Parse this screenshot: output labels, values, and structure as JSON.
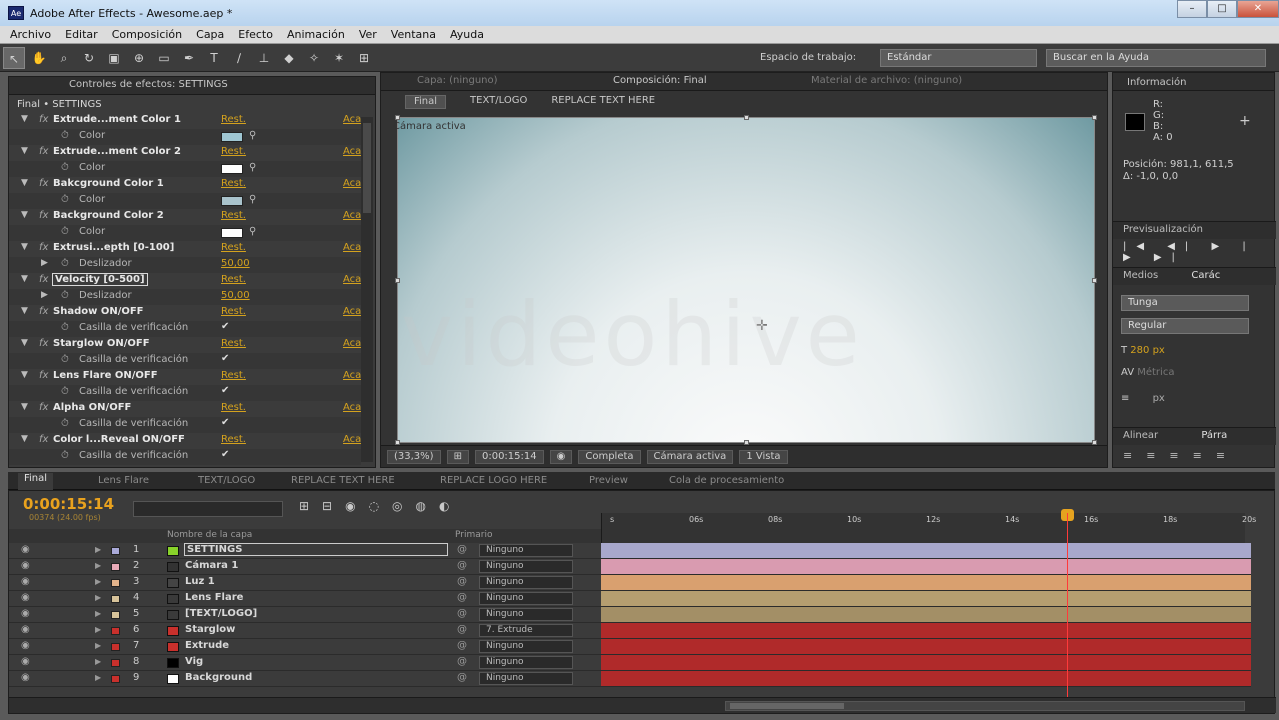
{
  "window": {
    "title": "Adobe After Effects - Awesome.aep *",
    "app_icon": "Ae"
  },
  "menu": [
    "Archivo",
    "Editar",
    "Composición",
    "Capa",
    "Efecto",
    "Animación",
    "Ver",
    "Ventana",
    "Ayuda"
  ],
  "toolbar": {
    "workspace_label": "Espacio de trabajo:",
    "workspace_value": "Estándar",
    "help_search": "Buscar en la Ayuda"
  },
  "effects": {
    "tab": "Controles de efectos: SETTINGS",
    "subtitle": "Final • SETTINGS",
    "reset_label": "Rest.",
    "about_label": "Aca",
    "rows": [
      {
        "kind": "eff",
        "name": "Extrude...ment Color 1"
      },
      {
        "kind": "prop",
        "name": "Color",
        "type": "color",
        "color": "#9fc6d2"
      },
      {
        "kind": "eff",
        "name": "Extrude...ment Color 2"
      },
      {
        "kind": "prop",
        "name": "Color",
        "type": "color",
        "color": "#ffffff"
      },
      {
        "kind": "eff",
        "name": "Bakcground Color 1"
      },
      {
        "kind": "prop",
        "name": "Color",
        "type": "color",
        "color": "#a9c3cc"
      },
      {
        "kind": "eff",
        "name": "Background Color 2"
      },
      {
        "kind": "prop",
        "name": "Color",
        "type": "color",
        "color": "#ffffff"
      },
      {
        "kind": "eff",
        "name": "Extrusi...epth [0-100]"
      },
      {
        "kind": "prop",
        "name": "Deslizador",
        "type": "value",
        "value": "50,00"
      },
      {
        "kind": "eff",
        "name": "Velocity [0-500]",
        "selected": true
      },
      {
        "kind": "prop",
        "name": "Deslizador",
        "type": "value",
        "value": "50,00"
      },
      {
        "kind": "eff",
        "name": "Shadow ON/OFF"
      },
      {
        "kind": "prop",
        "name": "Casilla de verificación",
        "type": "check"
      },
      {
        "kind": "eff",
        "name": "Starglow ON/OFF"
      },
      {
        "kind": "prop",
        "name": "Casilla de verificación",
        "type": "check"
      },
      {
        "kind": "eff",
        "name": "Lens Flare ON/OFF"
      },
      {
        "kind": "prop",
        "name": "Casilla de verificación",
        "type": "check"
      },
      {
        "kind": "eff",
        "name": "Alpha ON/OFF"
      },
      {
        "kind": "prop",
        "name": "Casilla de verificación",
        "type": "check"
      },
      {
        "kind": "eff",
        "name": "Color l...Reveal ON/OFF"
      },
      {
        "kind": "prop",
        "name": "Casilla de verificación",
        "type": "check"
      }
    ]
  },
  "composition": {
    "tabs": [
      "Capa: (ninguno)",
      "Composición: Final",
      "Material de archivo: (ninguno)"
    ],
    "flow": [
      "Final",
      "TEXT/LOGO",
      "REPLACE TEXT HERE"
    ],
    "camera_label": "Cámara activa",
    "zoom": "(33,3%)",
    "timecode": "0:00:15:14",
    "resolution": "Completa",
    "view_camera": "Cámara activa",
    "views": "1 Vista"
  },
  "info": {
    "tab": "Información",
    "rgb": [
      "R:",
      "G:",
      "B:",
      "A: 0"
    ],
    "position": "Posición: 981,1, 611,5",
    "delta": "Δ: -1,0, 0,0"
  },
  "preview": {
    "tab": "Previsualización",
    "controls": "|◀ ◀| ▶ |▶ ▶|"
  },
  "character": {
    "tabs": [
      "Medios",
      "Carác"
    ],
    "font": "Tunga",
    "style": "Regular",
    "size": "280 px",
    "kerning": "Métrica",
    "unit": "px"
  },
  "align": {
    "tabs": [
      "Alinear",
      "Párra"
    ]
  },
  "timeline": {
    "tabs": [
      "Final",
      "Lens Flare",
      "TEXT/LOGO",
      "REPLACE TEXT HERE",
      "REPLACE LOGO HERE",
      "Preview",
      "Cola de procesamiento"
    ],
    "timecode": "0:00:15:14",
    "timecode_small": "00374 (24.00 fps)",
    "col_name": "Nombre de la capa",
    "col_parent": "Primario",
    "ruler": [
      "s",
      "06s",
      "08s",
      "10s",
      "12s",
      "14s",
      "16s",
      "18s",
      "20s"
    ],
    "layers": [
      {
        "num": "1",
        "name": "SETTINGS",
        "label": "#a9a9d8",
        "src": "#88d22a",
        "parent": "Ninguno",
        "bar": "#a8a8cc",
        "selected": true
      },
      {
        "num": "2",
        "name": "Cámara 1",
        "label": "#e8aab8",
        "src": "#333333",
        "parent": "Ninguno",
        "bar": "#d99bb0"
      },
      {
        "num": "3",
        "name": "Luz 1",
        "label": "#e4b48c",
        "src": "#444444",
        "parent": "Ninguno",
        "bar": "#d9a06f"
      },
      {
        "num": "4",
        "name": "Lens Flare",
        "label": "#d7c39a",
        "src": "#3a3a3a",
        "parent": "Ninguno",
        "bar": "#b59e70"
      },
      {
        "num": "5",
        "name": "[TEXT/LOGO]",
        "label": "#d7c39a",
        "src": "#3a3a3a",
        "parent": "Ninguno",
        "bar": "#a38f66"
      },
      {
        "num": "6",
        "name": "Starglow",
        "label": "#c8302c",
        "src": "#c8302c",
        "parent": "7. Extrude",
        "bar": "#b02a2a"
      },
      {
        "num": "7",
        "name": "Extrude",
        "label": "#c8302c",
        "src": "#c8302c",
        "parent": "Ninguno",
        "bar": "#b02a2a"
      },
      {
        "num": "8",
        "name": "Vig",
        "label": "#c8302c",
        "src": "#000000",
        "parent": "Ninguno",
        "bar": "#b02a2a"
      },
      {
        "num": "9",
        "name": "Background",
        "label": "#c8302c",
        "src": "#ffffff",
        "parent": "Ninguno",
        "bar": "#b02a2a"
      }
    ]
  },
  "watermark": "videohive"
}
